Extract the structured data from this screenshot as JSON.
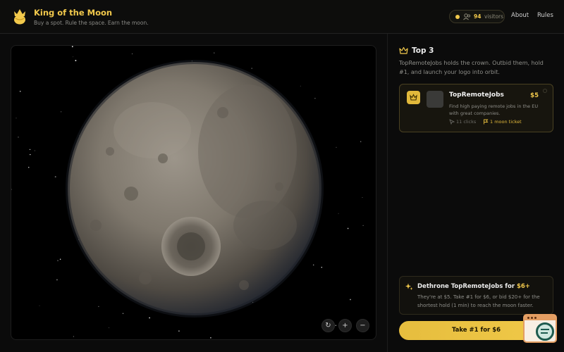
{
  "header": {
    "title": "King of the Moon",
    "tagline": "Buy a spot. Rule the space. Earn the moon.",
    "visitors_count": "94",
    "visitors_label": "visitors",
    "nav": {
      "about": "About",
      "rules": "Rules"
    }
  },
  "viewer": {
    "controls": {
      "reset": "↻",
      "zoom_in": "+",
      "zoom_out": "−"
    }
  },
  "leaderboard": {
    "title": "Top 3",
    "description": "TopRemoteJobs holds the crown. Outbid them, hold #1, and launch your logo into orbit.",
    "entries": [
      {
        "name": "TopRemoteJobs",
        "price": "$5",
        "description": "Find high paying remote jobs in the EU with great companies.",
        "clicks": "11 clicks",
        "tickets": "1 moon ticket"
      }
    ]
  },
  "dethrone": {
    "title_prefix": "Dethrone TopRemoteJobs for ",
    "title_amount": "$6+",
    "body": "They're at $5. Take #1 for $6, or bid $20+ for the shortest hold (1 min) to reach the moon faster."
  },
  "cta": {
    "label": "Take #1 for $6"
  },
  "colors": {
    "accent": "#f2c94c",
    "background": "#0b0b0b",
    "card_border": "#4a4122"
  }
}
